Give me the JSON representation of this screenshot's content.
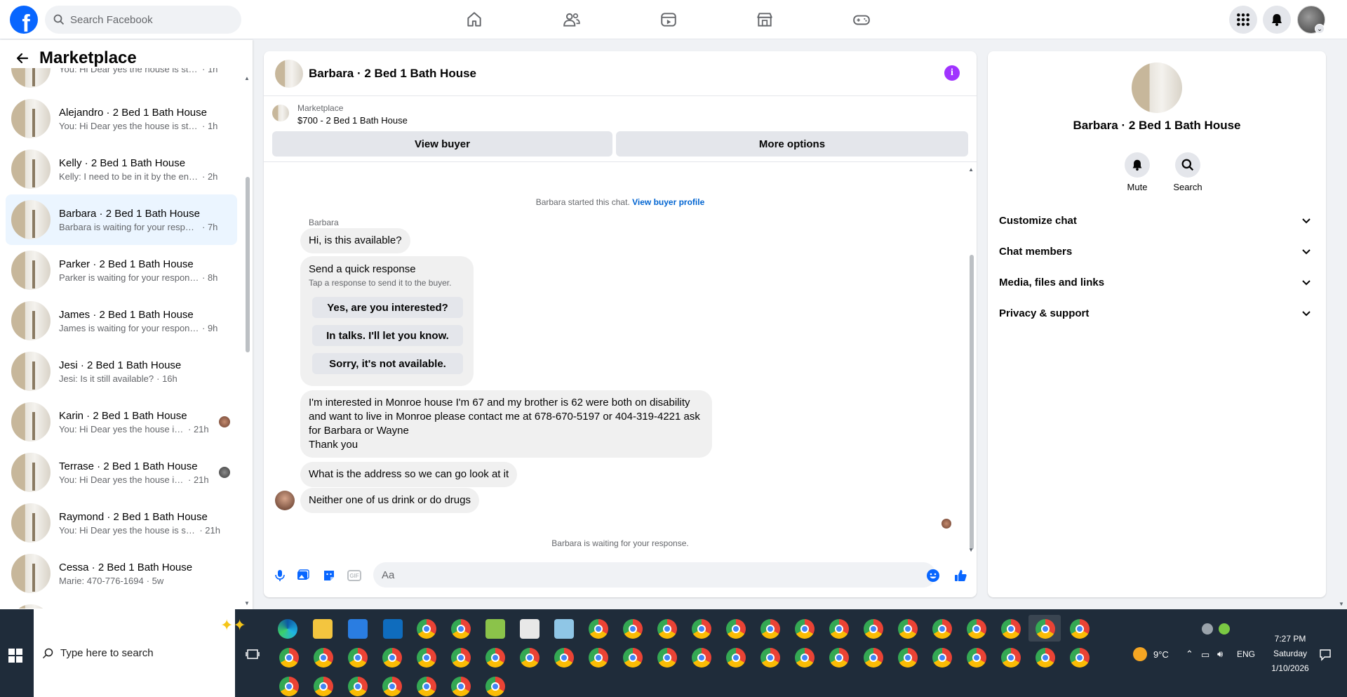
{
  "topbar": {
    "search_placeholder": "Search Facebook",
    "nav": [
      "home-icon",
      "friends-icon",
      "video-icon",
      "marketplace-icon",
      "gaming-icon"
    ]
  },
  "sidebar": {
    "title": "Marketplace",
    "items": [
      {
        "name": "",
        "snippet": "You: Hi Dear yes the house is still a...",
        "time": "· 1h"
      },
      {
        "name": "Alejandro · 2 Bed 1 Bath House",
        "snippet": "You: Hi Dear yes the house is still a...",
        "time": "· 1h"
      },
      {
        "name": "Kelly · 2 Bed 1 Bath House",
        "snippet": "Kelly: I need to be in it by the end ...",
        "time": "· 2h"
      },
      {
        "name": "Barbara · 2 Bed 1 Bath House",
        "snippet": "Barbara is waiting for your response.",
        "time": "· 7h"
      },
      {
        "name": "Parker · 2 Bed 1 Bath House",
        "snippet": "Parker is waiting for your response.",
        "time": "· 8h"
      },
      {
        "name": "James · 2 Bed 1 Bath House",
        "snippet": "James is waiting for your response.",
        "time": "· 9h"
      },
      {
        "name": "Jesi · 2 Bed 1 Bath House",
        "snippet": "Jesi: Is it still available?",
        "time": "· 16h"
      },
      {
        "name": "Karin · 2 Bed 1 Bath House",
        "snippet": "You: Hi Dear yes the house is st...",
        "time": "· 21h"
      },
      {
        "name": "Terrase · 2 Bed 1 Bath House",
        "snippet": "You: Hi Dear yes the house is st...",
        "time": "· 21h"
      },
      {
        "name": "Raymond · 2 Bed 1 Bath House",
        "snippet": "You: Hi Dear yes the house is still ...",
        "time": "· 21h"
      },
      {
        "name": "Cessa · 2 Bed 1 Bath House",
        "snippet": "Marie: 470-776-1694",
        "time": "· 5w"
      }
    ]
  },
  "chat": {
    "title": "Barbara · 2 Bed 1 Bath House",
    "listing_label": "Marketplace",
    "listing_title": "$700 - 2 Bed 1 Bath House",
    "view_buyer": "View buyer",
    "more_options": "More options",
    "started_text": "Barbara started this chat.",
    "view_buyer_profile": "View buyer profile",
    "sender": "Barbara",
    "msg1": "Hi, is this available?",
    "quick_title": "Send a quick response",
    "quick_sub": "Tap a response to send it to the buyer.",
    "quick_1": "Yes, are you interested?",
    "quick_2": "In talks. I'll let you know.",
    "quick_3": "Sorry, it's not available.",
    "msg2_line1": "I'm interested in Monroe house I'm 67 and my brother is 62 were both on disability",
    "msg2_line2": "and want to live in Monroe please contact me at 678-670-5197 or 404-319-4221 ask",
    "msg2_line3": "for Barbara or Wayne",
    "msg2_line4": "Thank you",
    "msg3": "What is the address so we can go look at it",
    "msg4": "Neither one of us drink or do drugs",
    "waiting": "Barbara is waiting for your response.",
    "composer_placeholder": "Aa"
  },
  "right_panel": {
    "name": "Barbara · 2 Bed 1 Bath House",
    "mute": "Mute",
    "search": "Search",
    "rows": [
      "Customize chat",
      "Chat members",
      "Media, files and links",
      "Privacy & support"
    ]
  },
  "taskbar": {
    "search_placeholder": "Type here to search",
    "weather": "9°C",
    "lang": "ENG",
    "time": "7:27 PM",
    "day": "Saturday",
    "date": "1/10/2026"
  },
  "colors": {
    "brand": "#0866ff",
    "accent_purple": "#a033ff",
    "link": "#0064d1"
  }
}
